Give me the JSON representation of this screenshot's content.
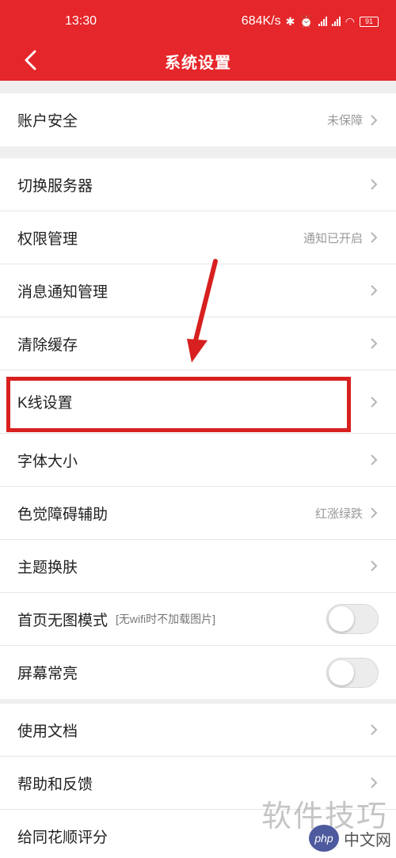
{
  "status_bar": {
    "time": "13:30",
    "net_speed": "684K/s",
    "battery": "91"
  },
  "header": {
    "title": "系统设置"
  },
  "groups": [
    {
      "items": [
        {
          "label": "账户安全",
          "value": "未保障"
        }
      ]
    },
    {
      "items": [
        {
          "label": "切换服务器",
          "value": ""
        },
        {
          "label": "权限管理",
          "value": "通知已开启"
        },
        {
          "label": "消息通知管理",
          "value": ""
        },
        {
          "label": "清除缓存",
          "value": ""
        },
        {
          "label": "K线设置",
          "value": ""
        },
        {
          "label": "字体大小",
          "value": ""
        },
        {
          "label": "色觉障碍辅助",
          "value": "红涨绿跌"
        },
        {
          "label": "主题换肤",
          "value": ""
        },
        {
          "label": "首页无图模式",
          "sub": "[无wifi时不加载图片]",
          "toggle_on": false
        },
        {
          "label": "屏幕常亮",
          "toggle_on": false
        }
      ]
    },
    {
      "items": [
        {
          "label": "使用文档",
          "value": ""
        },
        {
          "label": "帮助和反馈",
          "value": ""
        },
        {
          "label": "给同花顺评分",
          "value": ""
        }
      ]
    }
  ],
  "watermark": {
    "main": "软件技巧",
    "logo": "php",
    "site": "中文网"
  },
  "colors": {
    "brand_red": "#e5262a",
    "annotation_red": "#d7201f",
    "background": "#efefef"
  }
}
